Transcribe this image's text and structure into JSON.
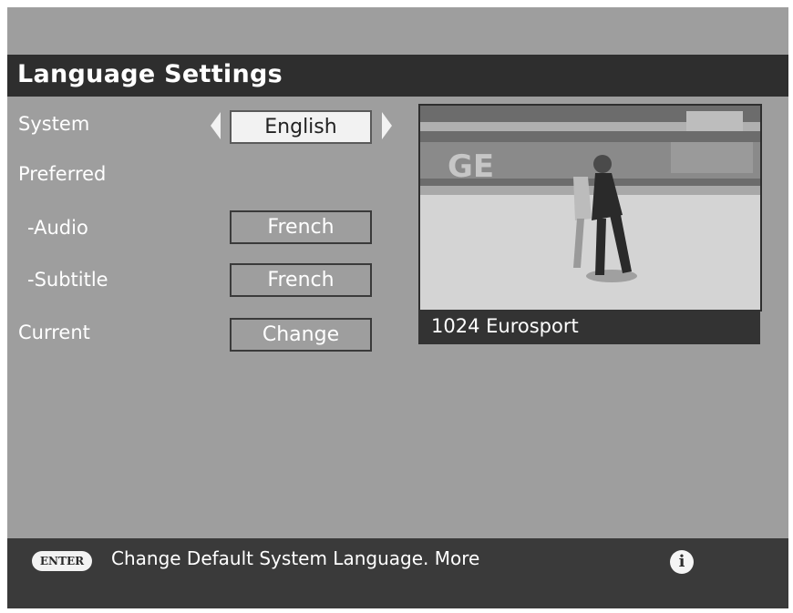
{
  "header": {
    "title": "Language Settings"
  },
  "settings": {
    "system_label": "System",
    "system_value": "English",
    "preferred_label": "Preferred",
    "audio_label": "-Audio",
    "audio_value": "French",
    "subtitle_label": "-Subtitle",
    "subtitle_value": "French",
    "current_label": "Current",
    "current_button": "Change"
  },
  "preview": {
    "channel": "1024 Eurosport"
  },
  "footer": {
    "enter_key": "ENTER",
    "hint": "Change Default System Language. More",
    "info_icon": "info-icon"
  },
  "colors": {
    "panel": "#9e9e9e",
    "bar": "#2e2e2e",
    "highlight": "#f2f2f2",
    "text": "#ffffff"
  }
}
